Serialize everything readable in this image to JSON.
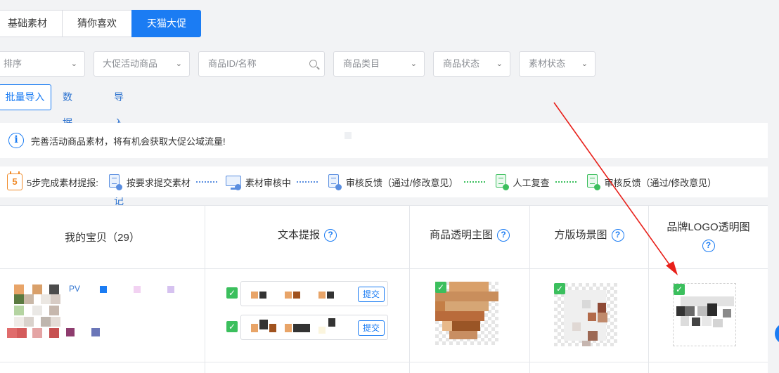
{
  "tabs": [
    {
      "label": "基础素材",
      "active": false
    },
    {
      "label": "猜你喜欢",
      "active": false
    },
    {
      "label": "天猫大促",
      "active": true
    }
  ],
  "filters": {
    "sort": "排序",
    "activity": "大促活动商品",
    "search_placeholder": "商品ID/名称",
    "category": "商品类目",
    "product_status": "商品状态",
    "material_status": "素材状态"
  },
  "actions": {
    "bulk_import": "批量导入",
    "data_export": "数据导出",
    "history": "导入导出记录"
  },
  "info": {
    "text": "完善活动商品素材，将有机会获取大促公域流量!"
  },
  "steps": {
    "intro": "5步完成素材提报:",
    "calendar_number": "5",
    "items": [
      "按要求提交素材",
      "素材审核中",
      "审核反馈（通过/修改意见）",
      "人工复查",
      "审核反馈（通过/修改意见）"
    ]
  },
  "table": {
    "headers": {
      "my_items": "我的宝贝（29）",
      "text_submit": "文本提报",
      "transparent_main": "商品透明主图",
      "square_scene": "方版场景图",
      "brand_logo": "品牌LOGO透明图"
    },
    "row": {
      "pv_prefix": "PV",
      "submit_label_1": "提交",
      "submit_label_2": "提交"
    }
  },
  "colors": {
    "accent": "#1b7cf3",
    "success": "#3bbf5d",
    "annotation": "#e8201a"
  }
}
